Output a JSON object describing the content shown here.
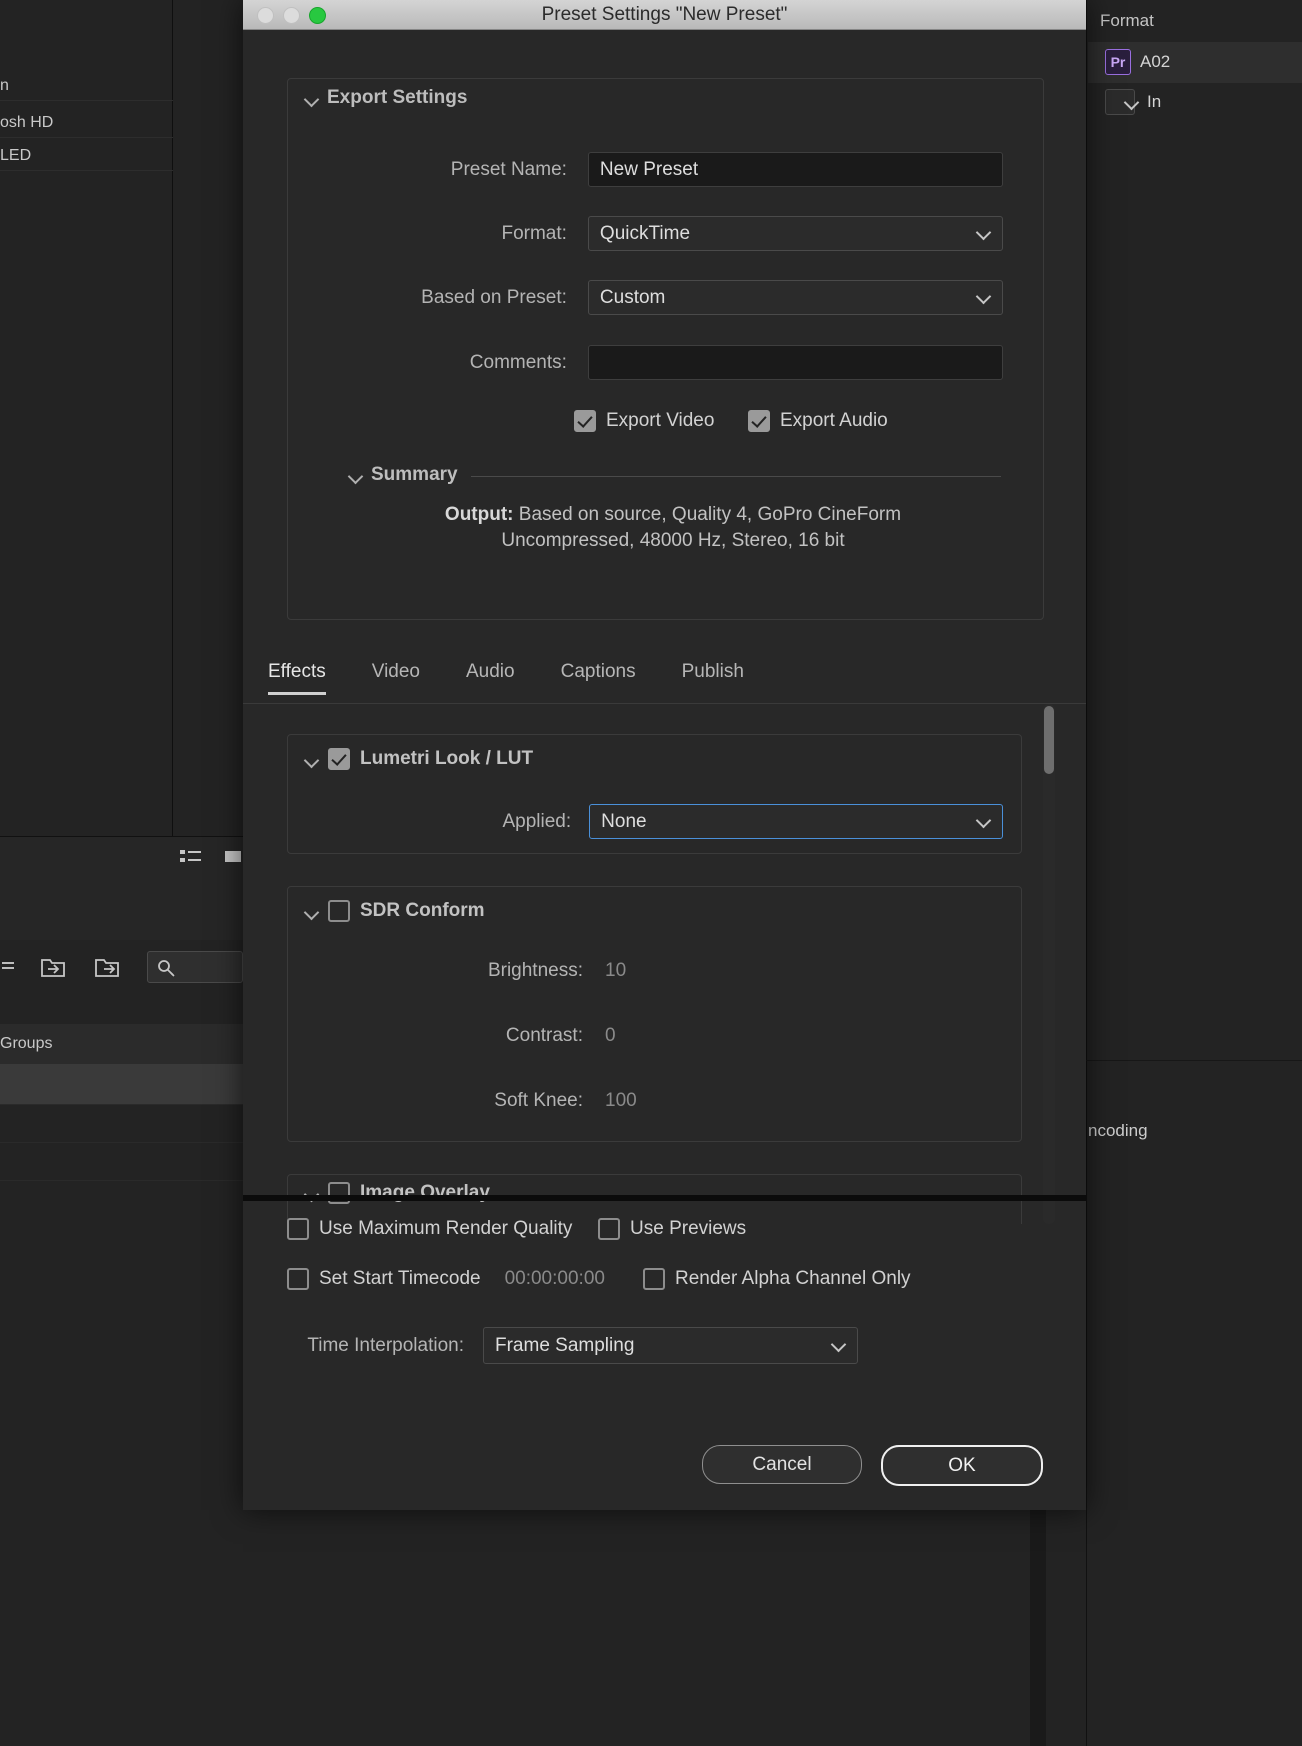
{
  "window": {
    "title": "Preset Settings \"New Preset\"",
    "traffic_lights": [
      "close-disabled",
      "minimize-disabled",
      "zoom-green"
    ]
  },
  "export_settings": {
    "group_title": "Export Settings",
    "fields": [
      {
        "label": "Preset Name:",
        "value": "New Preset",
        "type": "text"
      },
      {
        "label": "Format:",
        "value": "QuickTime",
        "type": "select"
      },
      {
        "label": "Based on Preset:",
        "value": "Custom",
        "type": "select"
      },
      {
        "label": "Comments:",
        "value": "",
        "type": "text"
      }
    ],
    "checkboxes": [
      {
        "label": "Export Video",
        "checked": true
      },
      {
        "label": "Export Audio",
        "checked": true
      }
    ],
    "summary": {
      "title": "Summary",
      "output_label": "Output:",
      "line1": "Based on source, Quality 4, GoPro CineForm",
      "line2": "Uncompressed, 48000 Hz, Stereo, 16 bit"
    }
  },
  "tabs": [
    {
      "label": "Effects",
      "active": true
    },
    {
      "label": "Video",
      "active": false
    },
    {
      "label": "Audio",
      "active": false
    },
    {
      "label": "Captions",
      "active": false
    },
    {
      "label": "Publish",
      "active": false
    }
  ],
  "effects": {
    "lumetri": {
      "title": "Lumetri Look / LUT",
      "checked": true,
      "applied_label": "Applied:",
      "applied_value": "None",
      "focus_color": "#4a90d9"
    },
    "sdr_conform": {
      "title": "SDR Conform",
      "checked": false,
      "rows": [
        {
          "label": "Brightness:",
          "value": "10"
        },
        {
          "label": "Contrast:",
          "value": "0"
        },
        {
          "label": "Soft Knee:",
          "value": "100"
        }
      ]
    },
    "image_overlay": {
      "title": "Image Overlay",
      "checked": false
    }
  },
  "footer": {
    "options": [
      {
        "label": "Use Maximum Render Quality",
        "checked": false
      },
      {
        "label": "Use Previews",
        "checked": false
      },
      {
        "label": "Set Start Timecode",
        "checked": false
      },
      {
        "label": "Render Alpha Channel Only",
        "checked": false
      }
    ],
    "timecode_value": "00:00:00:00",
    "time_interpolation_label": "Time Interpolation:",
    "time_interpolation_value": "Frame Sampling",
    "cancel_label": "Cancel",
    "ok_label": "OK"
  },
  "background": {
    "left_rows": [
      "n",
      "osh HD",
      "LED"
    ],
    "groups_label": "Groups",
    "right": {
      "header": "Format",
      "badge": "Pr",
      "item_label": "A02",
      "sub_label": "In",
      "encoding_label": "ncoding"
    }
  }
}
